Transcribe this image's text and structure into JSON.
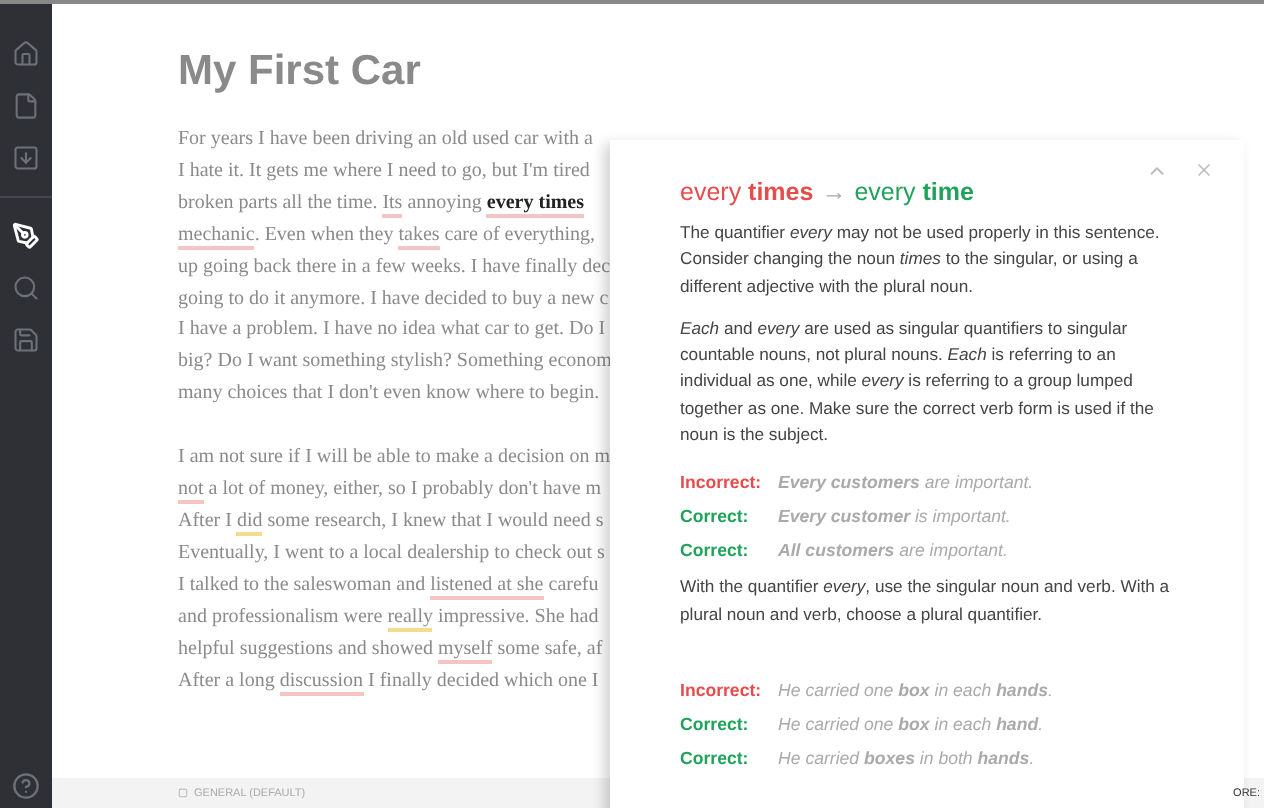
{
  "sidebar": {
    "items": [
      {
        "selected": false
      },
      {
        "selected": false
      },
      {
        "selected": false
      },
      {
        "selected": true
      },
      {
        "selected": false
      },
      {
        "selected": false
      }
    ]
  },
  "document": {
    "title": "My First Car",
    "paragraphs": [
      [
        [
          {
            "text": "For years I have been driving an old used car with a"
          }
        ],
        [
          {
            "text": "I hate it. It gets me where I need to go, but I'm tired"
          }
        ],
        [
          {
            "text": "broken parts all the time. "
          },
          {
            "text": "Its",
            "kind": "grammar"
          },
          {
            "text": " annoying "
          },
          {
            "text": "every times",
            "kind": "active"
          }
        ],
        [
          {
            "text": "mechanic",
            "kind": "grammar"
          },
          {
            "text": ". Even when they "
          },
          {
            "text": "takes",
            "kind": "grammar"
          },
          {
            "text": " care of everything,"
          }
        ],
        [
          {
            "text": "up going back there in a few weeks. I have finally dec"
          }
        ],
        [
          {
            "text": "going to do it anymore. I have decided to buy a new c"
          }
        ],
        [
          {
            "text": "I have a problem. I have no idea what car to get. Do I"
          }
        ],
        [
          {
            "text": "big? Do I want something stylish? Something econom"
          }
        ],
        [
          {
            "text": "many choices that I don't even know where to begin."
          }
        ]
      ],
      [
        [
          {
            "text": "I am not sure if I will be able to make a decision on m"
          }
        ],
        [
          {
            "text": "not",
            "kind": "grammar"
          },
          {
            "text": " a lot of money, either, so I probably don't have m"
          }
        ],
        [
          {
            "text": "After I "
          },
          {
            "text": "did",
            "kind": "clarity"
          },
          {
            "text": " some research, I knew that I would need s"
          }
        ],
        [
          {
            "text": "Eventually, I went to a local dealership to check out s"
          }
        ],
        [
          {
            "text": "I talked to the saleswoman and "
          },
          {
            "text": "listened at ",
            "kind": "grammar"
          },
          {
            "text": "she",
            "kind": "grammar"
          },
          {
            "text": " carefu"
          }
        ],
        [
          {
            "text": "and professionalism were "
          },
          {
            "text": "really",
            "kind": "clarity"
          },
          {
            "text": " impressive. She had"
          }
        ],
        [
          {
            "text": "helpful suggestions and showed "
          },
          {
            "text": "myself",
            "kind": "grammar"
          },
          {
            "text": " some safe, af"
          }
        ],
        [
          {
            "text": "After a long "
          },
          {
            "text": "discussion",
            "kind": "grammar"
          },
          {
            "text": " I finally decided which one I"
          }
        ]
      ]
    ]
  },
  "footer": {
    "label": "GENERAL (DEFAULT)",
    "right": "ORE:"
  },
  "panel": {
    "heading": {
      "wrong": "every **times**",
      "arrow": "→",
      "right": "every **time**"
    },
    "blocks": [
      {
        "kind": "paragraph",
        "text": "The quantifier *every* may not be used properly in this sentence. Consider changing the noun *times* to the singular, or using a different adjective with the plural noun."
      },
      {
        "kind": "paragraph",
        "text": "*Each* and *every* are used as singular quantifiers to singular countable nouns, not plural nouns. *Each* is referring to an individual as one, while *every* is referring to a group lumped together as one. Make sure the correct verb form is used if the noun is the subject."
      },
      {
        "kind": "example",
        "correct": false,
        "label": "Incorrect:",
        "sentence": "**Every customers** are important."
      },
      {
        "kind": "example",
        "correct": true,
        "label": "Correct:",
        "sentence": "**Every customer** is important."
      },
      {
        "kind": "example",
        "correct": true,
        "label": "Correct:",
        "sentence": "**All customers** are important."
      },
      {
        "kind": "paragraph",
        "text": "With the quantifier *every*, use the singular noun and verb. With a plural noun and verb, choose a plural quantifier."
      },
      {
        "kind": "example",
        "correct": false,
        "label": "Incorrect:",
        "sentence": "He carried one **box** in each **hands**."
      },
      {
        "kind": "example",
        "correct": true,
        "label": "Correct:",
        "sentence": "He carried one **box** in each **hand**."
      },
      {
        "kind": "example",
        "correct": true,
        "label": "Correct:",
        "sentence": "He carried **boxes** in both **hands**."
      }
    ]
  }
}
